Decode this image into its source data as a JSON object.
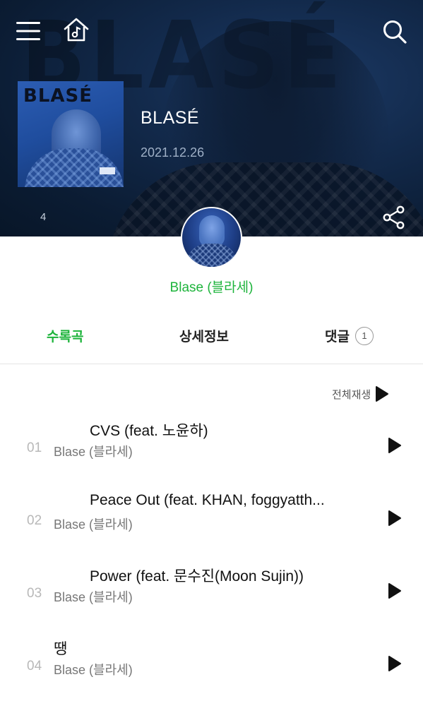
{
  "header": {
    "bg_text": "BLASÉ",
    "menu_icon": "menu-icon",
    "home_icon": "music-home-icon",
    "search_icon": "search-icon",
    "share_icon": "share-icon"
  },
  "album": {
    "cover_text": "BLASÉ",
    "title": "BLASÉ",
    "release_date": "2021.12.26",
    "count": "4"
  },
  "artist": {
    "name": "Blase (블라세)"
  },
  "tabs": [
    {
      "label": "수록곡",
      "active": true
    },
    {
      "label": "상세정보",
      "active": false
    },
    {
      "label": "댓글",
      "active": false,
      "badge": "1"
    }
  ],
  "play_all": {
    "label": "전체재생",
    "icon": "play-icon"
  },
  "tracks": [
    {
      "no": "01",
      "title": "CVS (feat. 노윤하)",
      "artist": "Blase (블라세)"
    },
    {
      "no": "02",
      "title": "Peace Out (feat. KHAN, foggyatth...",
      "artist": "Blase (블라세)"
    },
    {
      "no": "03",
      "title": "Power (feat. 문수진(Moon Sujin))",
      "artist": "Blase (블라세)"
    },
    {
      "no": "04",
      "title": "땡",
      "artist": "Blase (블라세)"
    }
  ],
  "colors": {
    "accent_green": "#1eb43c",
    "hero_bg": "#0b1c33"
  }
}
